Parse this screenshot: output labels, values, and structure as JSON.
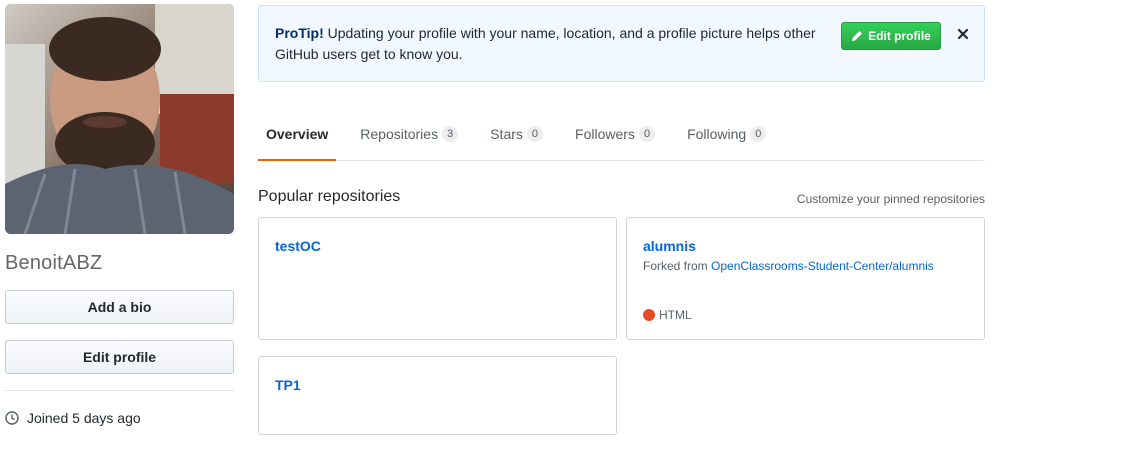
{
  "profile": {
    "username": "BenoitABZ",
    "add_bio_label": "Add a bio",
    "edit_profile_label": "Edit profile",
    "joined_text": "Joined 5 days ago"
  },
  "protip": {
    "label": "ProTip!",
    "message": "Updating your profile with your name, location, and a profile picture helps other GitHub users get to know you.",
    "edit_button": "Edit profile",
    "close_icon": "close-icon",
    "button_color": "#28a745"
  },
  "tabs": [
    {
      "label": "Overview",
      "count": null,
      "active": true
    },
    {
      "label": "Repositories",
      "count": "3",
      "active": false
    },
    {
      "label": "Stars",
      "count": "0",
      "active": false
    },
    {
      "label": "Followers",
      "count": "0",
      "active": false
    },
    {
      "label": "Following",
      "count": "0",
      "active": false
    }
  ],
  "popular": {
    "title": "Popular repositories",
    "customize_link": "Customize your pinned repositories",
    "repos": [
      {
        "name": "testOC"
      },
      {
        "name": "alumnis",
        "forked_prefix": "Forked from",
        "forked_source": "OpenClassrooms-Student-Center/alumnis",
        "language": "HTML",
        "language_color": "#e34c26"
      },
      {
        "name": "TP1"
      }
    ]
  },
  "colors": {
    "accent_tab": "#e36209",
    "link": "#0366d6"
  }
}
